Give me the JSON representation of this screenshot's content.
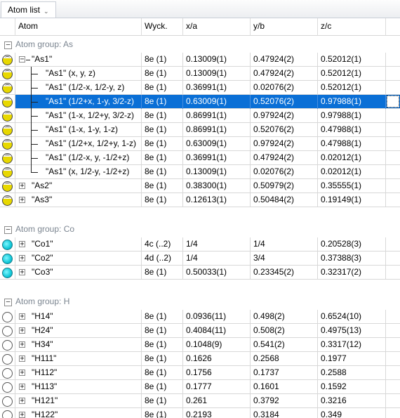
{
  "window": {
    "tab_title": "Atom list",
    "tab_caret": "⌄"
  },
  "columns": {
    "atom": "Atom",
    "wyck": "Wyck.",
    "x": "x/a",
    "y": "y/b",
    "z": "z/c"
  },
  "groups": [
    {
      "label": "Atom group: As",
      "element": "As",
      "icon": "arsenic-atom-icon",
      "rows": [
        {
          "name": "\"As1\"",
          "level": 0,
          "expander": "⊟",
          "wyck": "8e (1)",
          "x": "0.13009(1)",
          "y": "0.47924(2)",
          "z": "0.52012(1)"
        },
        {
          "name": "\"As1\" (x, y, z)",
          "level": 1,
          "wyck": "8e (1)",
          "x": "0.13009(1)",
          "y": "0.47924(2)",
          "z": "0.52012(1)"
        },
        {
          "name": "\"As1\" (1/2-x, 1/2-y, z)",
          "level": 1,
          "wyck": "8e (1)",
          "x": "0.36991(1)",
          "y": "0.02076(2)",
          "z": "0.52012(1)"
        },
        {
          "name": "\"As1\" (1/2+x, 1-y, 3/2-z)",
          "level": 1,
          "selected": true,
          "wyck": "8e (1)",
          "x": "0.63009(1)",
          "y": "0.52076(2)",
          "z": "0.97988(1)"
        },
        {
          "name": "\"As1\" (1-x, 1/2+y, 3/2-z)",
          "level": 1,
          "wyck": "8e (1)",
          "x": "0.86991(1)",
          "y": "0.97924(2)",
          "z": "0.97988(1)"
        },
        {
          "name": "\"As1\" (1-x, 1-y, 1-z)",
          "level": 1,
          "wyck": "8e (1)",
          "x": "0.86991(1)",
          "y": "0.52076(2)",
          "z": "0.47988(1)"
        },
        {
          "name": "\"As1\" (1/2+x, 1/2+y, 1-z)",
          "level": 1,
          "wyck": "8e (1)",
          "x": "0.63009(1)",
          "y": "0.97924(2)",
          "z": "0.47988(1)"
        },
        {
          "name": "\"As1\" (1/2-x, y, -1/2+z)",
          "level": 1,
          "wyck": "8e (1)",
          "x": "0.36991(1)",
          "y": "0.47924(2)",
          "z": "0.02012(1)"
        },
        {
          "name": "\"As1\" (x, 1/2-y, -1/2+z)",
          "level": 1,
          "last": true,
          "wyck": "8e (1)",
          "x": "0.13009(1)",
          "y": "0.02076(2)",
          "z": "0.02012(1)"
        },
        {
          "name": "\"As2\"",
          "level": 0,
          "expander": "⊞",
          "wyck": "8e (1)",
          "x": "0.38300(1)",
          "y": "0.50979(2)",
          "z": "0.35555(1)"
        },
        {
          "name": "\"As3\"",
          "level": 0,
          "expander": "⊞",
          "wyck": "8e (1)",
          "x": "0.12613(1)",
          "y": "0.50484(2)",
          "z": "0.19149(1)"
        }
      ]
    },
    {
      "label": "Atom group: Co",
      "element": "Co",
      "icon": "cobalt-atom-icon",
      "rows": [
        {
          "name": "\"Co1\"",
          "level": 0,
          "expander": "⊞",
          "wyck": "4c (..2)",
          "x": "1/4",
          "y": "1/4",
          "z": "0.20528(3)"
        },
        {
          "name": "\"Co2\"",
          "level": 0,
          "expander": "⊞",
          "wyck": "4d (..2)",
          "x": "1/4",
          "y": "3/4",
          "z": "0.37388(3)"
        },
        {
          "name": "\"Co3\"",
          "level": 0,
          "expander": "⊞",
          "wyck": "8e (1)",
          "x": "0.50033(1)",
          "y": "0.23345(2)",
          "z": "0.32317(2)"
        }
      ]
    },
    {
      "label": "Atom group: H",
      "element": "H",
      "icon": "hydrogen-atom-icon",
      "rows": [
        {
          "name": "\"H14\"",
          "level": 0,
          "expander": "⊞",
          "wyck": "8e (1)",
          "x": "0.0936(11)",
          "y": "0.498(2)",
          "z": "0.6524(10)"
        },
        {
          "name": "\"H24\"",
          "level": 0,
          "expander": "⊞",
          "wyck": "8e (1)",
          "x": "0.4084(11)",
          "y": "0.508(2)",
          "z": "0.4975(13)"
        },
        {
          "name": "\"H34\"",
          "level": 0,
          "expander": "⊞",
          "wyck": "8e (1)",
          "x": "0.1048(9)",
          "y": "0.541(2)",
          "z": "0.3317(12)"
        },
        {
          "name": "\"H111\"",
          "level": 0,
          "expander": "⊞",
          "wyck": "8e (1)",
          "x": "0.1626",
          "y": "0.2568",
          "z": "0.1977"
        },
        {
          "name": "\"H112\"",
          "level": 0,
          "expander": "⊞",
          "wyck": "8e (1)",
          "x": "0.1756",
          "y": "0.1737",
          "z": "0.2588"
        },
        {
          "name": "\"H113\"",
          "level": 0,
          "expander": "⊞",
          "wyck": "8e (1)",
          "x": "0.1777",
          "y": "0.1601",
          "z": "0.1592"
        },
        {
          "name": "\"H121\"",
          "level": 0,
          "expander": "⊞",
          "wyck": "8e (1)",
          "x": "0.261",
          "y": "0.3792",
          "z": "0.3216"
        },
        {
          "name": "\"H122\"",
          "level": 0,
          "expander": "⊞",
          "wyck": "8e (1)",
          "x": "0.2193",
          "y": "0.3184",
          "z": "0.349"
        }
      ]
    }
  ]
}
